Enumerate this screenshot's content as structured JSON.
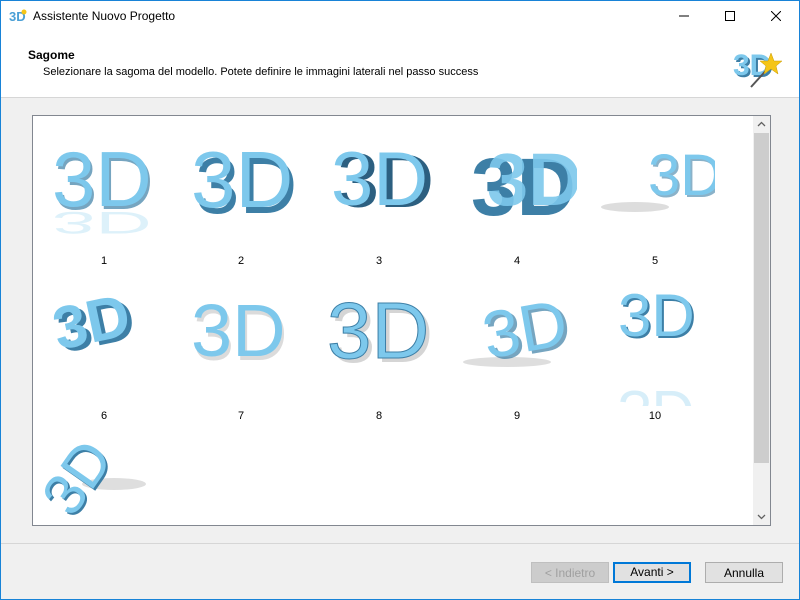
{
  "window": {
    "title": "Assistente Nuovo Progetto"
  },
  "header": {
    "title": "Sagome",
    "subtitle": "Selezionare la sagoma del modello. Potete definire le immagini laterali nel passo success"
  },
  "shapes": [
    {
      "label": "1"
    },
    {
      "label": "2"
    },
    {
      "label": "3"
    },
    {
      "label": "4"
    },
    {
      "label": "5"
    },
    {
      "label": "6"
    },
    {
      "label": "7"
    },
    {
      "label": "8"
    },
    {
      "label": "9"
    },
    {
      "label": "10"
    },
    {
      "label": ""
    }
  ],
  "buttons": {
    "back": "< Indietro",
    "next": "Avanti >",
    "cancel": "Annulla"
  },
  "colors": {
    "accent": "#1883d7",
    "shape_fill": "#7dc8ec",
    "shape_side": "#3d7fa6"
  }
}
